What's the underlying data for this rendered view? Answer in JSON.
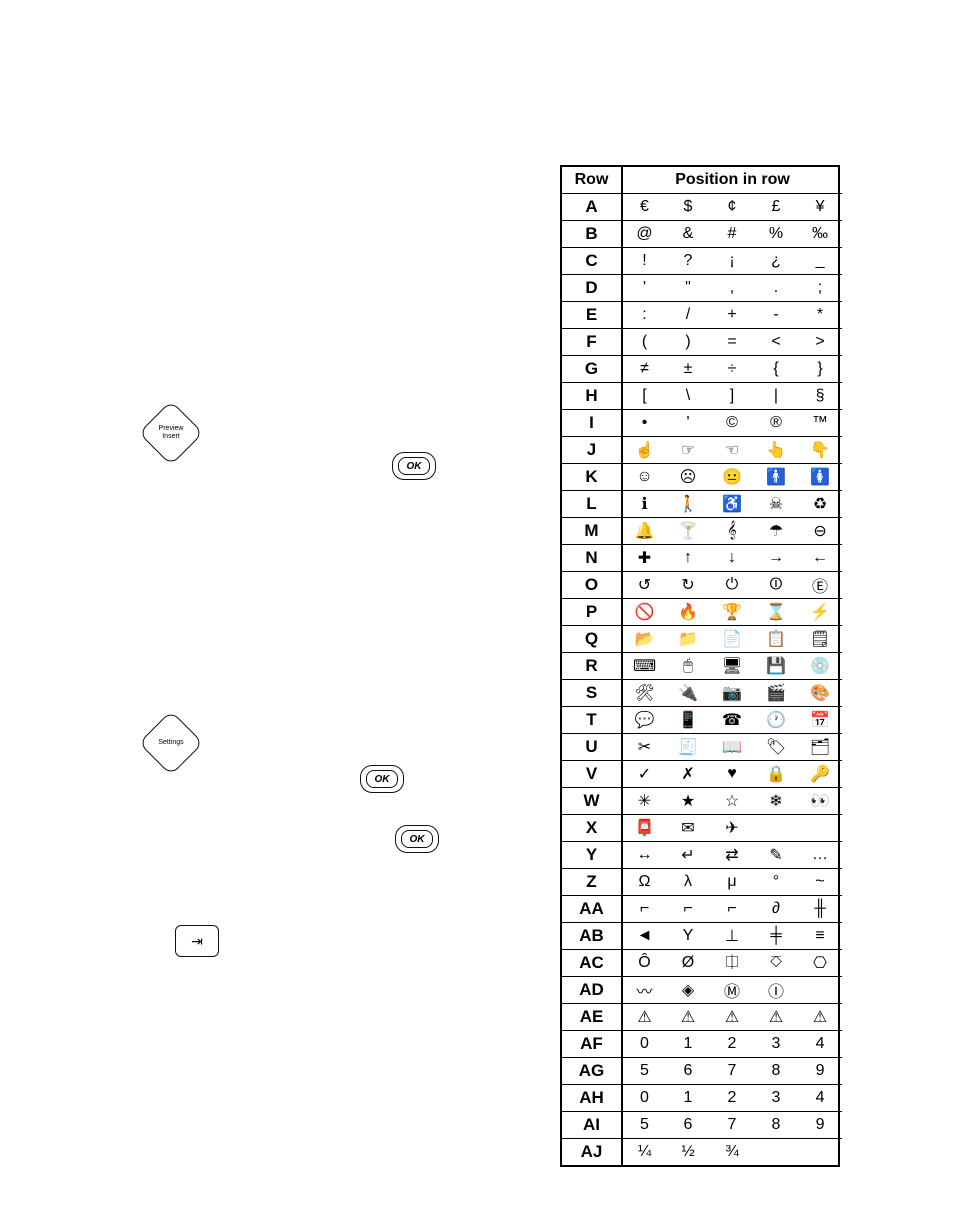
{
  "left_controls": {
    "preview_key": {
      "line1": "Preview",
      "line2": "Insert"
    },
    "settings_key": {
      "line1": "Settings"
    },
    "ok1_label": "OK",
    "ok2_label": "OK",
    "ok3_label": "OK",
    "tab_glyph": "⇥"
  },
  "table": {
    "header_row": "Row",
    "header_pos": "Position in row",
    "rows": [
      {
        "label": "A",
        "cells": [
          "€",
          "$",
          "¢",
          "£",
          "¥"
        ]
      },
      {
        "label": "B",
        "cells": [
          "@",
          "&",
          "#",
          "%",
          "‰"
        ]
      },
      {
        "label": "C",
        "cells": [
          "!",
          "?",
          "¡",
          "¿",
          "_"
        ]
      },
      {
        "label": "D",
        "cells": [
          "'",
          "\"",
          ",",
          ".",
          ";"
        ]
      },
      {
        "label": "E",
        "cells": [
          ":",
          "/",
          "+",
          "-",
          "*"
        ]
      },
      {
        "label": "F",
        "cells": [
          "(",
          ")",
          "=",
          "<",
          ">"
        ]
      },
      {
        "label": "G",
        "cells": [
          "≠",
          "±",
          "÷",
          "{",
          "}"
        ]
      },
      {
        "label": "H",
        "cells": [
          "[",
          "\\",
          "]",
          "|",
          "§"
        ]
      },
      {
        "label": "I",
        "cells": [
          "•",
          "'",
          "©",
          "®",
          "™"
        ]
      },
      {
        "label": "J",
        "cells": [
          "☝",
          "☞",
          "☜",
          "👆",
          "👇"
        ]
      },
      {
        "label": "K",
        "cells": [
          "☺",
          "☹",
          "😐",
          "🚹",
          "🚺"
        ]
      },
      {
        "label": "L",
        "cells": [
          "ℹ",
          "🚶",
          "♿",
          "☠",
          "♻"
        ]
      },
      {
        "label": "M",
        "cells": [
          "🔔",
          "🍸",
          "𝄞",
          "☂",
          "⊖"
        ]
      },
      {
        "label": "N",
        "cells": [
          "✚",
          "↑",
          "↓",
          "→",
          "←"
        ]
      },
      {
        "label": "O",
        "cells": [
          "↺",
          "↻",
          "⏻",
          "⏼",
          "Ⓔ"
        ]
      },
      {
        "label": "P",
        "cells": [
          "🚫",
          "🔥",
          "🏆",
          "⌛",
          "⚡"
        ]
      },
      {
        "label": "Q",
        "cells": [
          "📂",
          "📁",
          "📄",
          "📋",
          "🗒"
        ]
      },
      {
        "label": "R",
        "cells": [
          "⌨",
          "🖱",
          "🖥",
          "💾",
          "💿"
        ]
      },
      {
        "label": "S",
        "cells": [
          "🛠",
          "🔌",
          "📷",
          "🎬",
          "🎨"
        ]
      },
      {
        "label": "T",
        "cells": [
          "💬",
          "📱",
          "☎",
          "🕐",
          "📅"
        ]
      },
      {
        "label": "U",
        "cells": [
          "✂",
          "🧾",
          "📖",
          "🏷",
          "🗂"
        ]
      },
      {
        "label": "V",
        "cells": [
          "✓",
          "✗",
          "♥",
          "🔒",
          "🔑"
        ]
      },
      {
        "label": "W",
        "cells": [
          "✳",
          "★",
          "☆",
          "❄",
          "👀"
        ]
      },
      {
        "label": "X",
        "cells": [
          "📮",
          "✉",
          "✈",
          "",
          ""
        ]
      },
      {
        "label": "Y",
        "cells": [
          "↔",
          "↵",
          "⇄",
          "✎",
          "…"
        ]
      },
      {
        "label": "Z",
        "cells": [
          "Ω",
          "λ",
          "μ",
          "°",
          "~"
        ]
      },
      {
        "label": "AA",
        "cells": [
          "⌐",
          "⌐",
          "⌐",
          "∂",
          "╫"
        ]
      },
      {
        "label": "AB",
        "cells": [
          "◄",
          "Y",
          "⊥",
          "╪",
          "≡"
        ]
      },
      {
        "label": "AC",
        "cells": [
          "Ô",
          "Ø",
          "⎅",
          "⎏",
          "⎔"
        ]
      },
      {
        "label": "AD",
        "cells": [
          "〰",
          "◈",
          "Ⓜ",
          "Ⓘ",
          ""
        ]
      },
      {
        "label": "AE",
        "cells": [
          "⚠",
          "⚠",
          "⚠",
          "⚠",
          "⚠"
        ]
      },
      {
        "label": "AF",
        "cells": [
          "0",
          "1",
          "2",
          "3",
          "4"
        ]
      },
      {
        "label": "AG",
        "cells": [
          "5",
          "6",
          "7",
          "8",
          "9"
        ]
      },
      {
        "label": "AH",
        "cells": [
          "0",
          "1",
          "2",
          "3",
          "4"
        ]
      },
      {
        "label": "AI",
        "cells": [
          "5",
          "6",
          "7",
          "8",
          "9"
        ]
      },
      {
        "label": "AJ",
        "cells": [
          "¼",
          "½",
          "¾",
          "",
          ""
        ]
      }
    ]
  }
}
